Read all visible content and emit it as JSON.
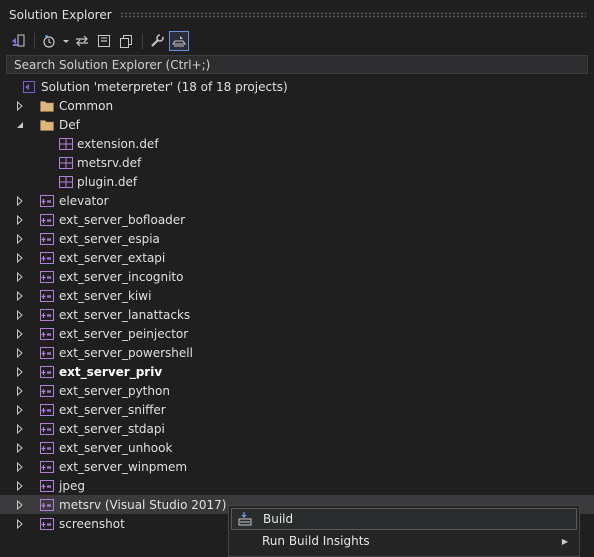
{
  "window": {
    "title": "Solution Explorer"
  },
  "toolbar": {
    "buttons": [
      {
        "name": "switch-views-icon"
      },
      {
        "name": "pending-changes-filter-icon"
      },
      {
        "name": "dropdown-arrow-icon"
      },
      {
        "name": "sync-active-document-icon"
      },
      {
        "name": "collapse-all-icon"
      },
      {
        "name": "show-all-files-icon"
      },
      {
        "name": "properties-wrench-icon"
      },
      {
        "name": "preview-selected-items-icon"
      }
    ]
  },
  "search": {
    "placeholder": "Search Solution Explorer (Ctrl+;)"
  },
  "tree": {
    "solution": "Solution 'meterpreter' (18 of 18 projects)",
    "items": [
      {
        "label": "Common",
        "kind": "folder",
        "expanded": false,
        "level": 1
      },
      {
        "label": "Def",
        "kind": "folder",
        "expanded": true,
        "level": 1
      },
      {
        "label": "extension.def",
        "kind": "file",
        "level": 2
      },
      {
        "label": "metsrv.def",
        "kind": "file",
        "level": 2
      },
      {
        "label": "plugin.def",
        "kind": "file",
        "level": 2
      },
      {
        "label": "elevator",
        "kind": "project",
        "level": 1
      },
      {
        "label": "ext_server_bofloader",
        "kind": "project",
        "level": 1
      },
      {
        "label": "ext_server_espia",
        "kind": "project",
        "level": 1
      },
      {
        "label": "ext_server_extapi",
        "kind": "project",
        "level": 1
      },
      {
        "label": "ext_server_incognito",
        "kind": "project",
        "level": 1
      },
      {
        "label": "ext_server_kiwi",
        "kind": "project",
        "level": 1
      },
      {
        "label": "ext_server_lanattacks",
        "kind": "project",
        "level": 1
      },
      {
        "label": "ext_server_peinjector",
        "kind": "project",
        "level": 1
      },
      {
        "label": "ext_server_powershell",
        "kind": "project",
        "level": 1
      },
      {
        "label": "ext_server_priv",
        "kind": "project",
        "level": 1,
        "bold": true
      },
      {
        "label": "ext_server_python",
        "kind": "project",
        "level": 1
      },
      {
        "label": "ext_server_sniffer",
        "kind": "project",
        "level": 1
      },
      {
        "label": "ext_server_stdapi",
        "kind": "project",
        "level": 1
      },
      {
        "label": "ext_server_unhook",
        "kind": "project",
        "level": 1
      },
      {
        "label": "ext_server_winpmem",
        "kind": "project",
        "level": 1
      },
      {
        "label": "jpeg",
        "kind": "project",
        "level": 1
      },
      {
        "label": "metsrv (Visual Studio 2017)",
        "kind": "project",
        "level": 1,
        "selected": true
      },
      {
        "label": "screenshot",
        "kind": "project",
        "level": 1
      }
    ]
  },
  "context_menu": {
    "items": [
      {
        "label": "Build",
        "icon": "build-icon",
        "hover": true
      },
      {
        "label": "Run Build Insights",
        "icon": "",
        "submenu": true
      }
    ]
  },
  "colors": {
    "background": "#1f1f1f",
    "selection": "#3a3a3d",
    "folder": "#dcb67a",
    "project_icon": "#b180d7",
    "solution_icon": "#7c5cd6",
    "active_border": "#6e8ee6"
  }
}
